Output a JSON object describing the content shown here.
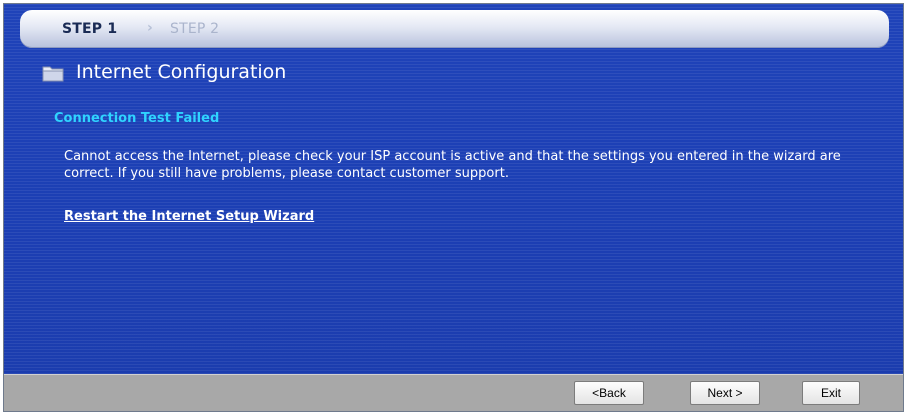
{
  "wizard": {
    "steps": [
      {
        "label": "STEP 1",
        "active": true
      },
      {
        "label": "STEP 2",
        "active": false
      }
    ],
    "step_separator_icon": "chevron-right-icon"
  },
  "header": {
    "icon": "folder-icon",
    "title": "Internet Configuration"
  },
  "content": {
    "status_heading": "Connection Test Failed",
    "message": "Cannot access the Internet, please check your ISP account is active and that the settings you entered in the wizard are correct. If you still have problems, please contact customer support.",
    "restart_link": "Restart the Internet Setup Wizard"
  },
  "footer": {
    "back_label": "<Back",
    "next_label": "Next >",
    "exit_label": "Exit"
  },
  "colors": {
    "panel_blue": "#1f43b9",
    "heading_cyan": "#2fd3ff",
    "footer_gray": "#a8a8a8"
  }
}
